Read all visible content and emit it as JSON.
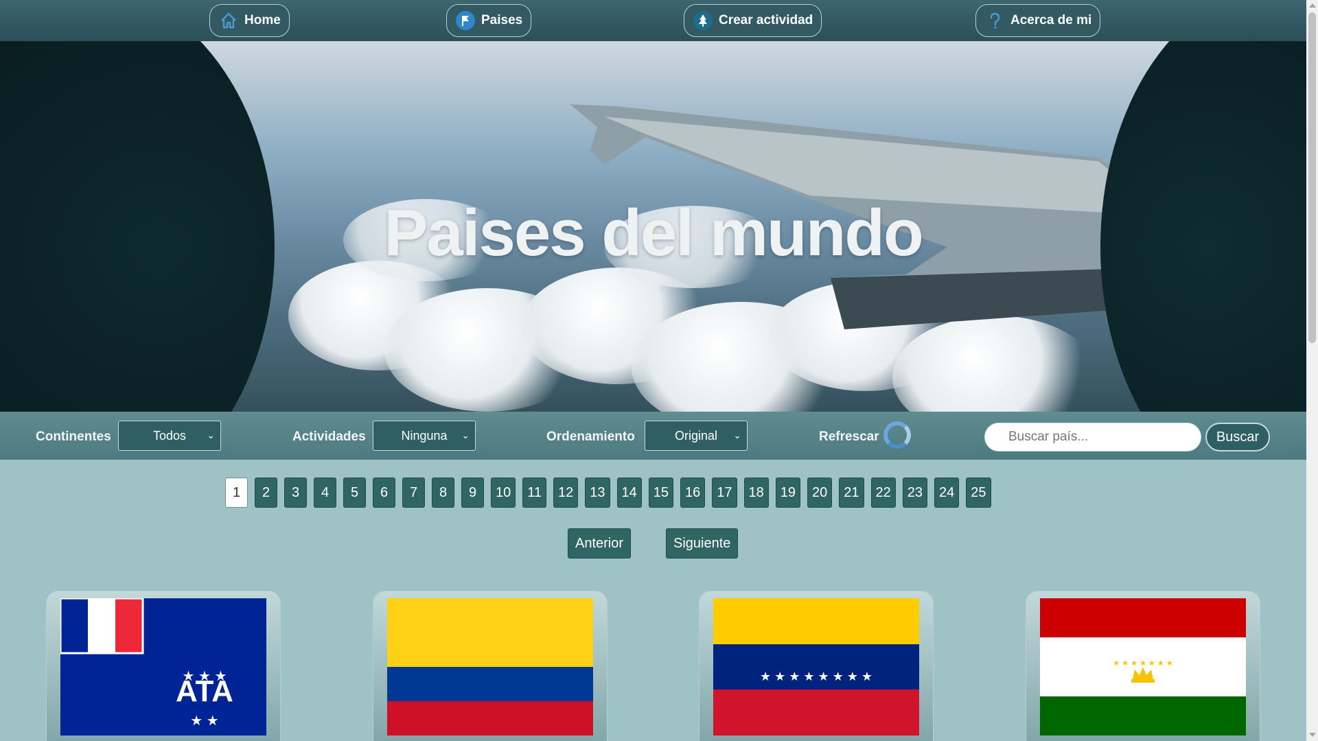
{
  "nav": {
    "items": [
      {
        "label": "Home",
        "icon": "home-icon"
      },
      {
        "label": "Paises",
        "icon": "flag-icon"
      },
      {
        "label": "Crear actividad",
        "icon": "tree-icon"
      },
      {
        "label": "Acerca de mi",
        "icon": "question-icon"
      }
    ]
  },
  "hero": {
    "title": "Paises del mundo"
  },
  "filters": {
    "continents_label": "Continentes",
    "continents_value": "Todos",
    "activities_label": "Actividades",
    "activities_value": "Ninguna",
    "order_label": "Ordenamiento",
    "order_value": "Original",
    "refresh_label": "Refrescar",
    "search_placeholder": "Buscar país...",
    "search_button": "Buscar"
  },
  "pagination": {
    "pages": [
      "1",
      "2",
      "3",
      "4",
      "5",
      "6",
      "7",
      "8",
      "9",
      "10",
      "11",
      "12",
      "13",
      "14",
      "15",
      "16",
      "17",
      "18",
      "19",
      "20",
      "21",
      "22",
      "23",
      "24",
      "25"
    ],
    "current": "1",
    "prev_label": "Anterior",
    "next_label": "Siguiente"
  },
  "cards": [
    {
      "flag": "french-southern-territories-flag"
    },
    {
      "flag": "colombia-flag"
    },
    {
      "flag": "venezuela-flag"
    },
    {
      "flag": "tajikistan-flag"
    }
  ],
  "colors": {
    "nav_bg": "#335a63",
    "accent": "#2f6563",
    "page_bg": "#9fc3c4"
  }
}
